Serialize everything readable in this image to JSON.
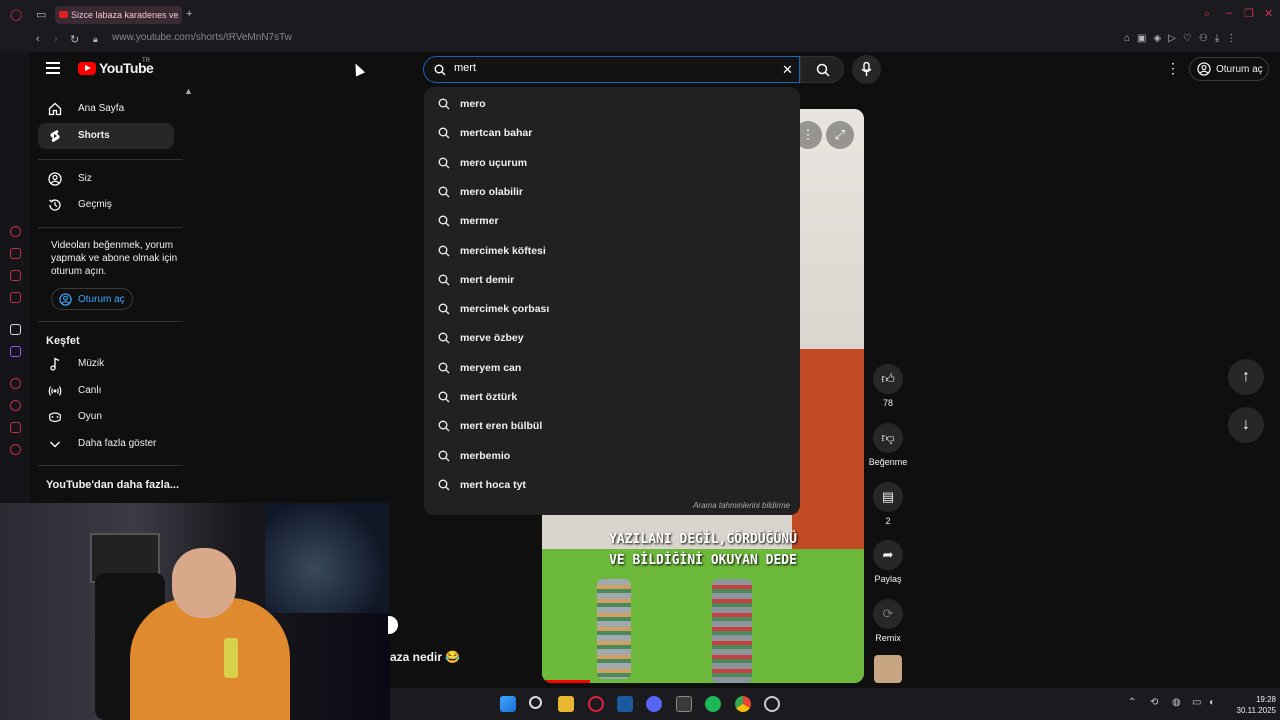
{
  "browser": {
    "tab_title": "Sizce labaza karadenes ve",
    "url": "www.youtube.com/shorts/tRVeMnN7sTw"
  },
  "masthead": {
    "logo_text": "YouTube",
    "logo_sup": "TR",
    "search_value": "mert",
    "signin_label": "Oturum aç"
  },
  "nav": {
    "items_top": [
      {
        "label": "Ana Sayfa",
        "icon": "home-icon"
      },
      {
        "label": "Shorts",
        "icon": "shorts-icon"
      }
    ],
    "items_you": [
      {
        "label": "Siz",
        "icon": "user-icon"
      },
      {
        "label": "Geçmiş",
        "icon": "history-icon"
      }
    ],
    "prompt_text": "Videoları beğenmek, yorum yapmak ve abone olmak için oturum açın.",
    "prompt_signin": "Oturum aç",
    "explore_heading": "Keşfet",
    "explore_items": [
      {
        "label": "Müzik",
        "icon": "music-icon"
      },
      {
        "label": "Canlı",
        "icon": "live-icon"
      },
      {
        "label": "Oyun",
        "icon": "gaming-icon"
      },
      {
        "label": "Daha fazla göster",
        "icon": "chevron-down-icon"
      }
    ],
    "more_heading": "YouTube'dan daha fazla..."
  },
  "suggestions": {
    "items": [
      "mero",
      "mertcan bahar",
      "mero uçurum",
      "mero olabilir",
      "mermer",
      "mercimek köftesi",
      "mert demir",
      "mercimek çorbası",
      "merve özbey",
      "meryem can",
      "mert öztürk",
      "mert eren bülbül",
      "merbemio",
      "mert hoca tyt"
    ],
    "report_label": "Arama tahminlerini bildirme"
  },
  "video": {
    "caption_line1": "YAZILANI DEĞİL,GÖRDÜĞÜNÜ",
    "caption_line2": "VE BİLDİĞİNİ OKUYAN DEDE",
    "title_fragment": "aza nedir 😂",
    "progress_fraction": 0.15
  },
  "actions": {
    "like_count": "78",
    "dislike_label": "Beğenme",
    "comment_count": "2",
    "share_label": "Paylaş",
    "remix_label": "Remix"
  },
  "taskbar": {
    "time": "19:28",
    "date": "30.11.2025"
  },
  "colors": {
    "accent_blue": "#3ea6ff",
    "yt_red": "#ff0000",
    "search_focus": "#1c62b9"
  }
}
